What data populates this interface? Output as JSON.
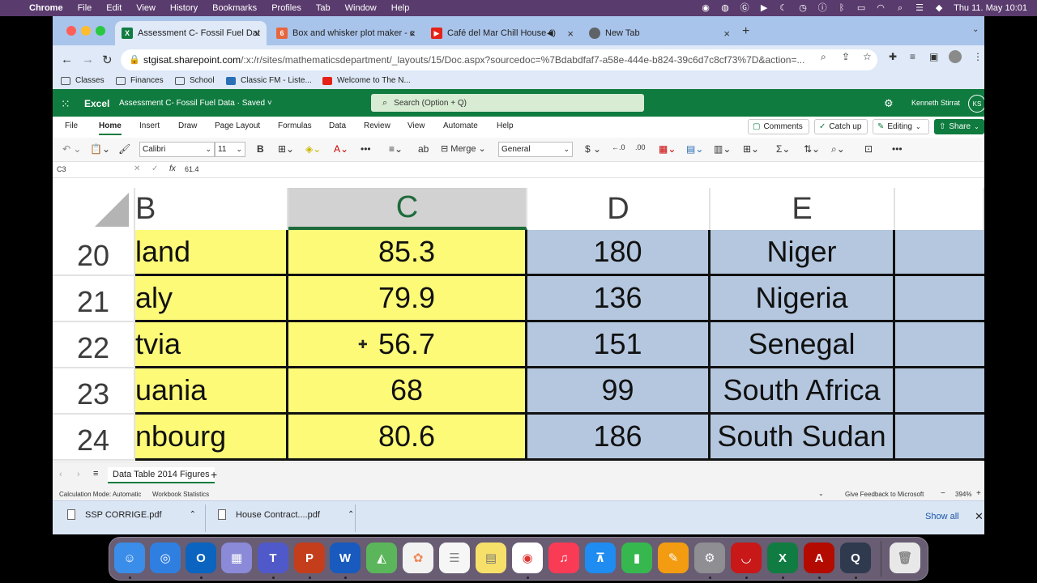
{
  "menubar": {
    "apple": "",
    "items": [
      "Chrome",
      "File",
      "Edit",
      "View",
      "History",
      "Bookmarks",
      "Profiles",
      "Tab",
      "Window",
      "Help"
    ],
    "datetime": "Thu 11. May  10:01"
  },
  "tabs": [
    {
      "title": "Assessment C- Fossil Fuel Dat",
      "active": true,
      "icon": "excel-icon",
      "color": "#107c41"
    },
    {
      "title": "Box and whisker plot maker - c",
      "active": false,
      "icon": "box-plot-icon",
      "color": "#e8663d"
    },
    {
      "title": "Café del Mar Chill House C",
      "active": false,
      "icon": "youtube-icon",
      "color": "#e62117"
    },
    {
      "title": "New Tab",
      "active": false,
      "icon": "chrome-icon",
      "color": "#5f6368"
    }
  ],
  "address": {
    "host": "stgisat.sharepoint.com",
    "path": "/:x:/r/sites/mathematicsdepartment/_layouts/15/Doc.aspx?sourcedoc=%7Bdabdfaf7-a58e-444e-b824-39c6d7c8cf73%7D&action=..."
  },
  "bookmarks": [
    "Classes",
    "Finances",
    "School",
    "Classic FM - Liste...",
    "Welcome to The N..."
  ],
  "excel": {
    "app": "Excel",
    "doc_title": "Assessment C- Fossil Fuel Data  ·  Saved ˅",
    "search_placeholder": "Search (Option + Q)",
    "user": "Kenneth Stirrat",
    "initials": "KS"
  },
  "ribbon_tabs": [
    "File",
    "Home",
    "Insert",
    "Draw",
    "Page Layout",
    "Formulas",
    "Data",
    "Review",
    "View",
    "Automate",
    "Help"
  ],
  "ribbon_buttons": {
    "comments": "Comments",
    "catch_up": "Catch up",
    "editing": "Editing",
    "share": "Share"
  },
  "toolbar": {
    "font": "Calibri",
    "size": "11",
    "merge": "Merge",
    "number_format": "General"
  },
  "formula": {
    "cell": "C3",
    "value": "61.4"
  },
  "columns": [
    "B",
    "C",
    "D",
    "E"
  ],
  "rows": [
    {
      "num": "20",
      "b": "land",
      "c": "85.3",
      "d": "180",
      "e": "Niger"
    },
    {
      "num": "21",
      "b": "aly",
      "c": "79.9",
      "d": "136",
      "e": "Nigeria"
    },
    {
      "num": "22",
      "b": "tvia",
      "c": "56.7",
      "d": "151",
      "e": "Senegal"
    },
    {
      "num": "23",
      "b": "uania",
      "c": "68",
      "d": "99",
      "e": "South Africa"
    },
    {
      "num": "24",
      "b": "nbourg",
      "c": "80.6",
      "d": "186",
      "e": "South Sudan"
    }
  ],
  "sheet": {
    "name": "Data Table 2014 Figures",
    "add": "+"
  },
  "status": {
    "calc": "Calculation Mode: Automatic",
    "stats": "Workbook Statistics",
    "feedback": "Give Feedback to Microsoft",
    "zoom": "394%"
  },
  "downloads": {
    "files": [
      "SSP CORRIGE.pdf",
      "House Contract....pdf"
    ],
    "show_all": "Show all"
  },
  "colors": {
    "excel_green": "#0f7b3f",
    "yellow_fill": "#fdfa78",
    "blue_fill": "#b4c7df"
  }
}
